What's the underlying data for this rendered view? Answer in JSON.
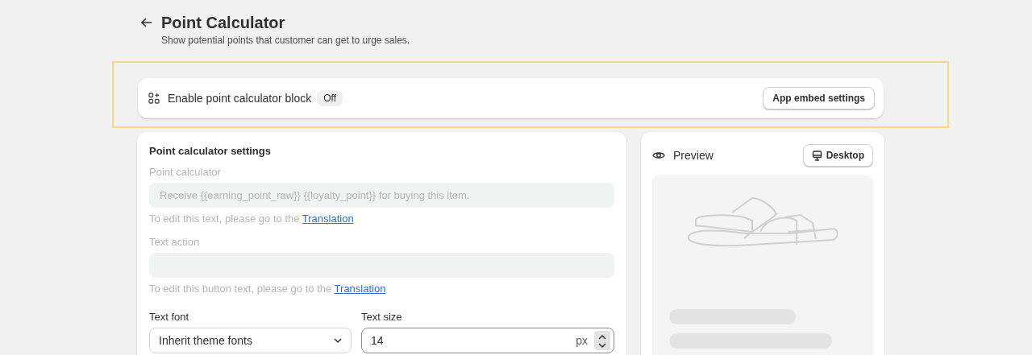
{
  "header": {
    "title": "Point Calculator",
    "subtitle": "Show potential points that customer can get to urge sales."
  },
  "embed_block": {
    "label": "Enable point calculator block",
    "status": "Off",
    "highlighted": true,
    "button": "App embed settings"
  },
  "settings": {
    "title": "Point calculator settings",
    "fields": [
      {
        "label": "Point calculator",
        "value": "Receive {{earning_point_raw}} {{loyalty_point}} for buying this item.",
        "disabled": true,
        "help": "To edit this text, please go to the",
        "link": "Translation"
      },
      {
        "label": "Text action",
        "disabled": true,
        "help": "To edit this button text, please go to the",
        "link": "Translation"
      }
    ],
    "font": {
      "label": "Text font",
      "value": "Inherit theme fonts"
    },
    "size": {
      "label": "Text size",
      "value": "14",
      "unit": "px"
    }
  },
  "preview": {
    "title": "Preview",
    "button": "Desktop"
  }
}
